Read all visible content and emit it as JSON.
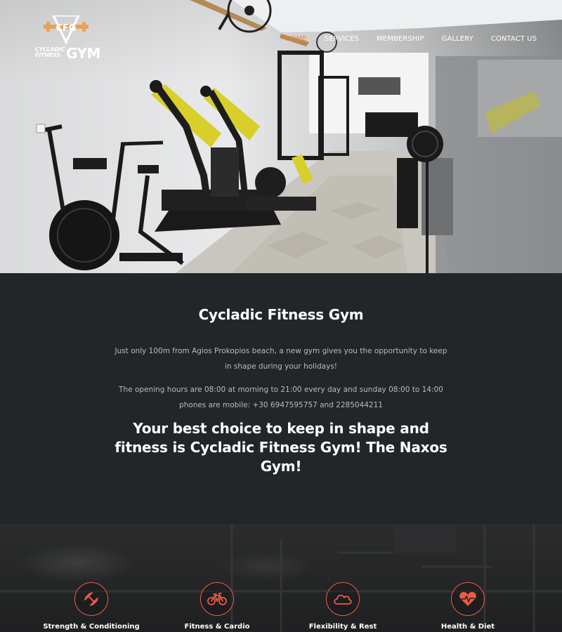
{
  "brand": {
    "logo_monogram": "CFG",
    "logo_small_line1": "CYCLADIC",
    "logo_small_line2": "FITNESS",
    "logo_big": "GYM",
    "accent_color": "#f37e3c",
    "icon_ring_color": "#f05a44"
  },
  "nav": {
    "items": [
      {
        "label": "HOME",
        "active": true
      },
      {
        "label": "SERVICES"
      },
      {
        "label": "MEMBERSHIP"
      },
      {
        "label": "GALLERY"
      },
      {
        "label": "CONTACT US"
      }
    ]
  },
  "intro": {
    "title": "Cycladic Fitness Gym",
    "paragraph1": "Just only 100m from Agios Prokopios beach, a new gym gives you the opportunity to keep in shape during your holidays!",
    "paragraph2": "The opening hours are 08:00 at morning to 21:00 every day and sunday 08:00 to 14:00 phones are mobile: +30 6947595757 and 2285044211",
    "headline": "Your best choice to keep in shape and fitness is Cycladic Fitness Gym! The Naxos Gym!"
  },
  "features": [
    {
      "label": "Strength & Conditioning",
      "icon": "dumbbell-icon"
    },
    {
      "label": "Fitness & Cardio",
      "icon": "bicycle-icon"
    },
    {
      "label": "Flexibility & Rest",
      "icon": "cloud-icon"
    },
    {
      "label": "Health & Diet",
      "icon": "heartbeat-icon"
    }
  ]
}
